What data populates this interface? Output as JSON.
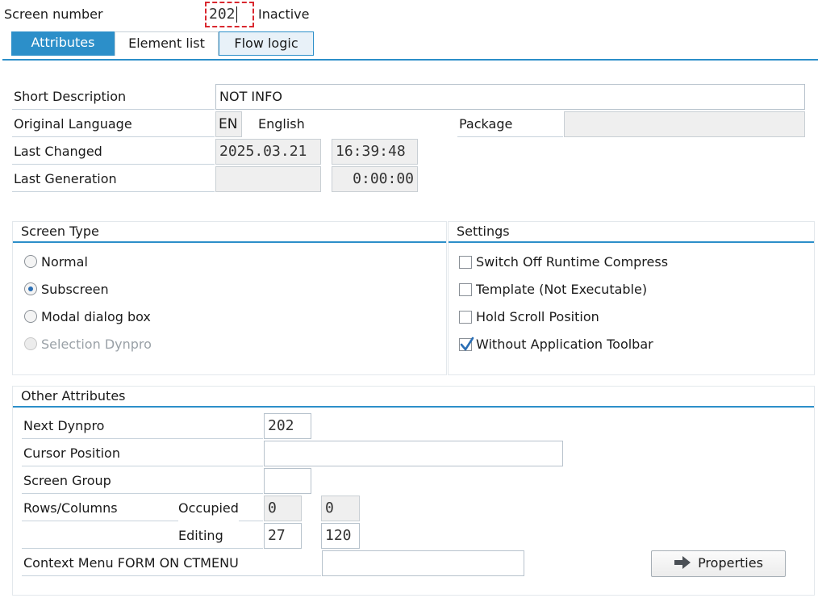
{
  "header": {
    "screen_number_label": "Screen number",
    "screen_number_value": "202",
    "status": "Inactive"
  },
  "tabs": [
    {
      "label": "Attributes",
      "active": true
    },
    {
      "label": "Element list",
      "active": false
    },
    {
      "label": "Flow logic",
      "active": false
    }
  ],
  "attributes": {
    "short_description_label": "Short Description",
    "short_description_value": "NOT INFO",
    "original_language_label": "Original Language",
    "language_code": "EN",
    "language_name": "English",
    "package_label": "Package",
    "package_value": "",
    "last_changed_label": "Last Changed",
    "last_changed_date": "2025.03.21",
    "last_changed_time": "16:39:48",
    "last_generation_label": "Last Generation",
    "last_generation_date": "",
    "last_generation_time": "0:00:00"
  },
  "screen_type": {
    "title": "Screen Type",
    "options": [
      {
        "label": "Normal",
        "selected": false,
        "disabled": false
      },
      {
        "label": "Subscreen",
        "selected": true,
        "disabled": false
      },
      {
        "label": "Modal dialog box",
        "selected": false,
        "disabled": false
      },
      {
        "label": "Selection Dynpro",
        "selected": false,
        "disabled": true
      }
    ]
  },
  "settings": {
    "title": "Settings",
    "options": [
      {
        "label": "Switch Off Runtime Compress",
        "checked": false
      },
      {
        "label": "Template (Not Executable)",
        "checked": false
      },
      {
        "label": "Hold Scroll Position",
        "checked": false
      },
      {
        "label": "Without Application Toolbar",
        "checked": true
      }
    ]
  },
  "other": {
    "title": "Other Attributes",
    "next_dynpro_label": "Next Dynpro",
    "next_dynpro_value": "202",
    "cursor_position_label": "Cursor Position",
    "cursor_position_value": "",
    "screen_group_label": "Screen Group",
    "screen_group_value": "",
    "rows_columns_label": "Rows/Columns",
    "occupied_label": "Occupied",
    "occupied_rows": "0",
    "occupied_cols": "0",
    "editing_label": "Editing",
    "editing_rows": "27",
    "editing_cols": "120",
    "context_menu_label": "Context Menu FORM ON CTMENU",
    "context_menu_value": "",
    "properties_button": "Properties"
  },
  "colors": {
    "accent": "#2c8fc9",
    "tab_active_bg": "#2c8fc9",
    "focus_red": "#d9282f"
  }
}
